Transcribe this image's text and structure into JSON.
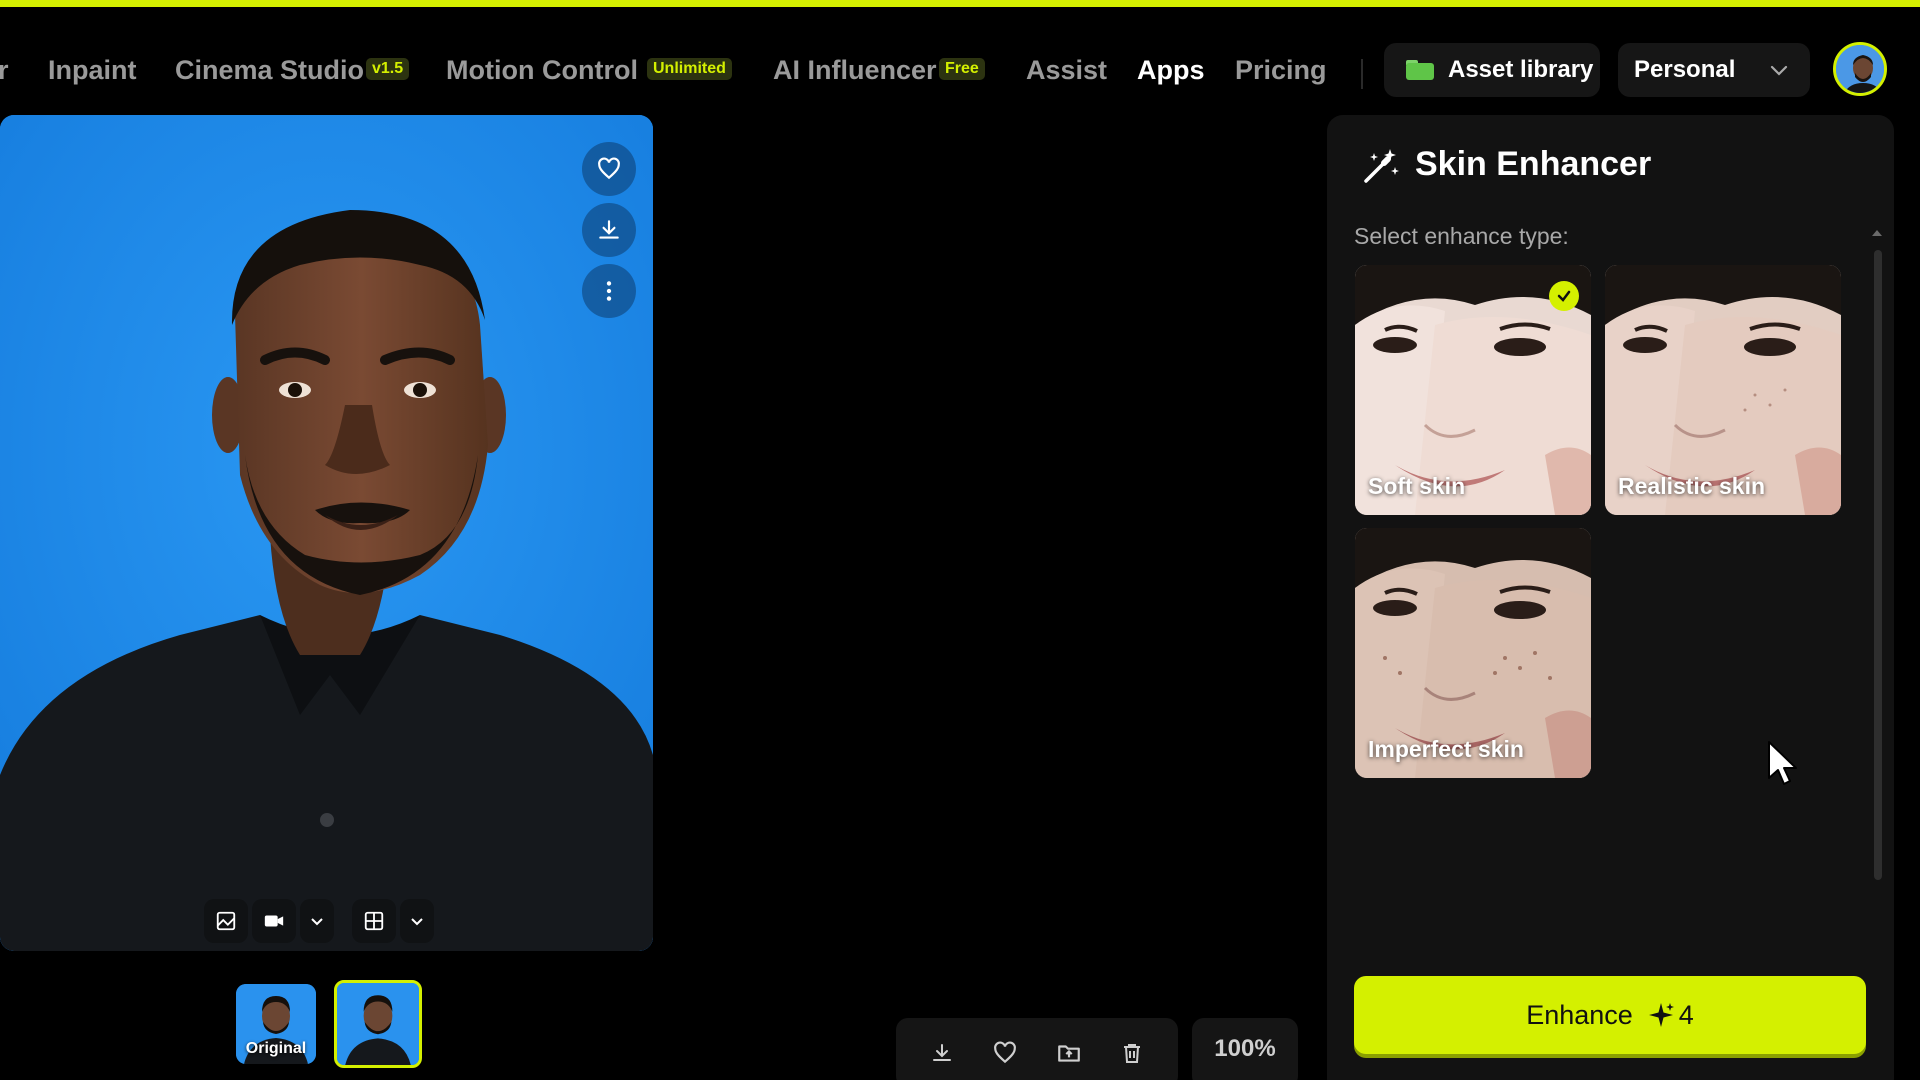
{
  "nav": {
    "cutoff": "r",
    "inpaint": "Inpaint",
    "cinema_studio": "Cinema Studio",
    "cinema_badge": "v1.5",
    "motion_control": "Motion Control",
    "motion_badge": "Unlimited",
    "ai_influencer": "AI Influencer",
    "influencer_badge": "Free",
    "assist": "Assist",
    "apps": "Apps",
    "pricing": "Pricing"
  },
  "header": {
    "asset_library": "Asset library",
    "workspace": "Personal"
  },
  "thumbnails": {
    "original_label": "Original"
  },
  "zoom": "100%",
  "panel": {
    "title": "Skin Enhancer",
    "subtitle": "Select enhance type:",
    "options": [
      {
        "label": "Soft skin",
        "selected": true
      },
      {
        "label": "Realistic skin",
        "selected": false
      },
      {
        "label": "Imperfect skin",
        "selected": false
      }
    ],
    "enhance_label": "Enhance",
    "enhance_cost": "4"
  },
  "colors": {
    "accent": "#d4f000",
    "background": "#000000",
    "panel": "#121212"
  }
}
